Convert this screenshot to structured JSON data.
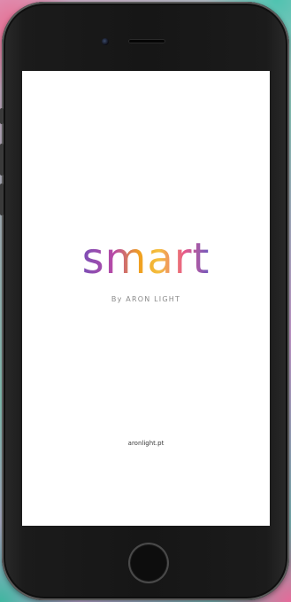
{
  "app": {
    "logo_text": "smart",
    "tagline": "By ARON LIGHT",
    "website": "aronlight.pt"
  },
  "colors": {
    "logo_gradient": [
      "#7b4fb6",
      "#b84aa6",
      "#f0a020",
      "#f4c040",
      "#e85a8a",
      "#6a5ac0"
    ],
    "tagline": "#8a8a8a",
    "screen_bg": "#ffffff",
    "phone_body": "#161616"
  },
  "icons": [
    "camera-icon",
    "speaker-icon",
    "home-button-icon"
  ]
}
